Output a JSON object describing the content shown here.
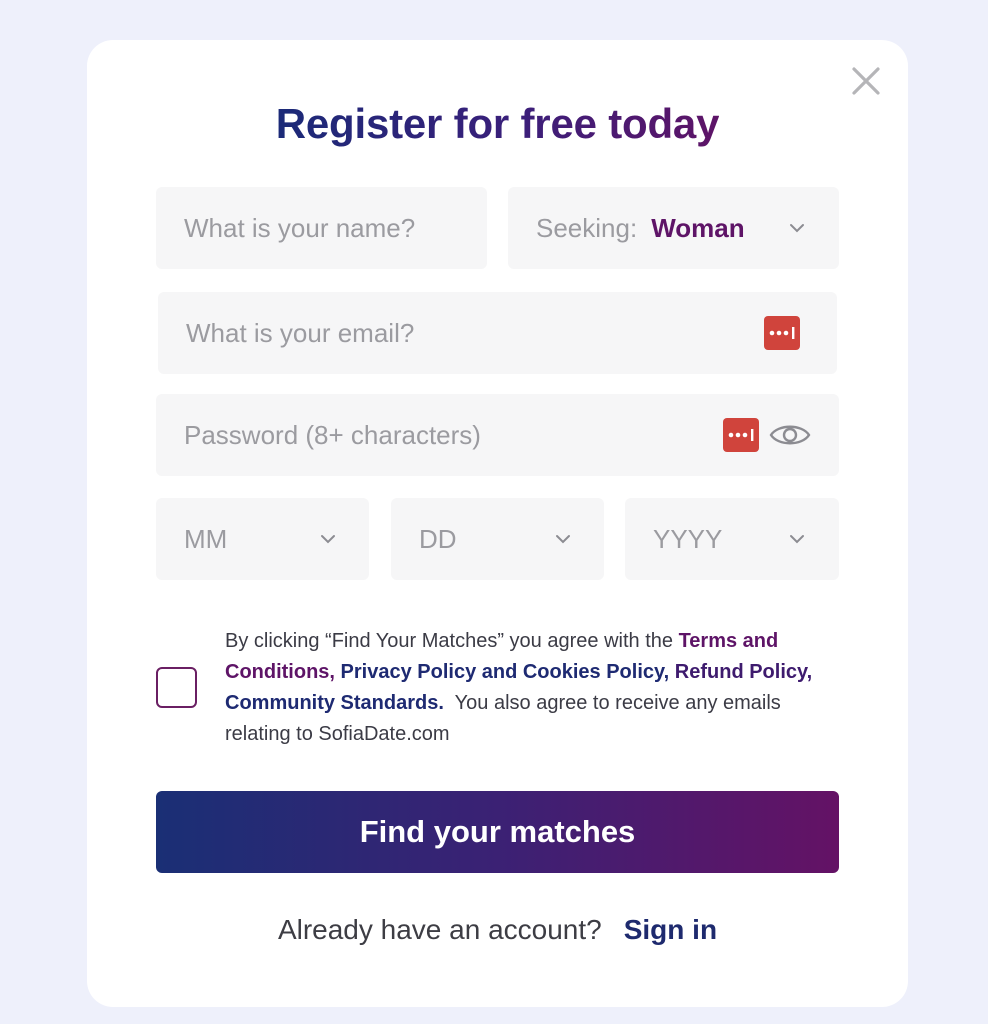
{
  "title": "Register for free today",
  "fields": {
    "name_placeholder": "What is your name?",
    "seeking_label": "Seeking:",
    "seeking_value": "Woman",
    "email_placeholder": "What is your email?",
    "password_placeholder": "Password (8+ characters)",
    "month_placeholder": "MM",
    "day_placeholder": "DD",
    "year_placeholder": "YYYY"
  },
  "terms": {
    "prefix": "By clicking “Find Your Matches” you agree with the ",
    "terms_link": "Terms and Conditions,",
    "privacy_link": "Privacy Policy and Cookies Policy,",
    "refund_link": "Refund Policy,",
    "community_link": "Community Standards.",
    "suffix": "  You also agree to receive any emails relating to SofiaDate.com"
  },
  "cta_label": "Find your matches",
  "signin": {
    "prompt": "Already have an account?",
    "link": "Sign in"
  },
  "colors": {
    "title": "#24226e",
    "accent_purple": "#5e1467",
    "accent_navy": "#1e2a72",
    "password_manager": "#d0443c",
    "field_bg": "#f6f6f7",
    "page_bg": "#eef0fb"
  },
  "icons": {
    "close": "close-icon",
    "chevron": "chevron-down-icon",
    "password_manager": "password-manager-icon",
    "eye": "eye-icon"
  }
}
